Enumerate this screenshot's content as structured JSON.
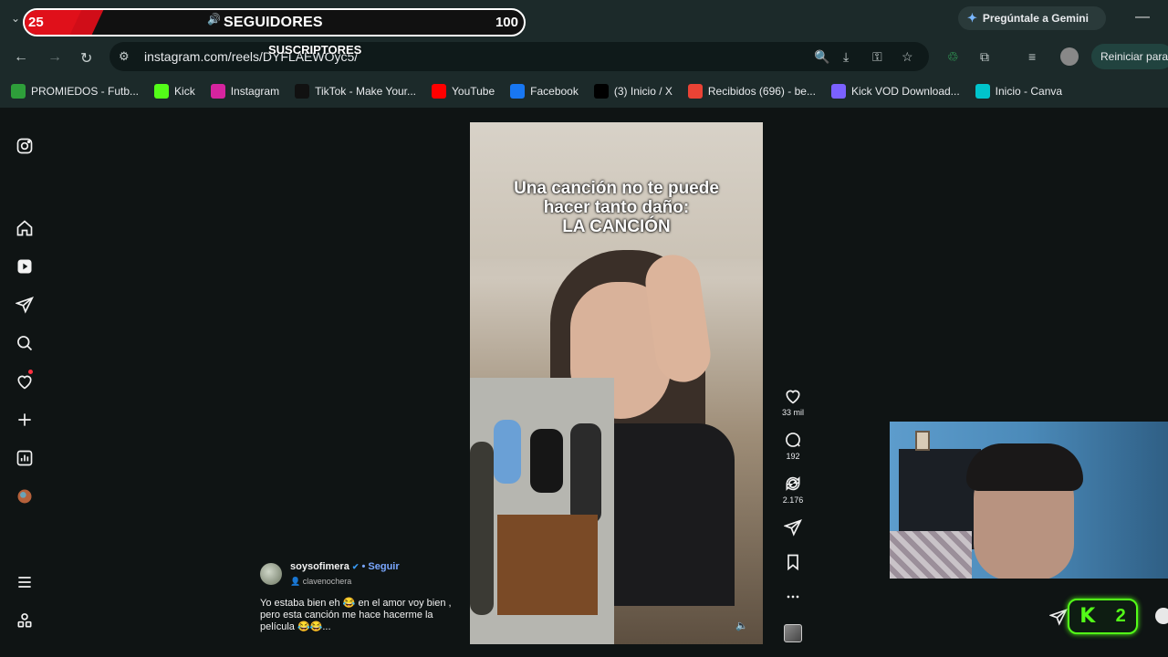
{
  "overlay": {
    "left_count": "25",
    "label": "SEGUIDORES",
    "right_count": "100",
    "sublabel": "SUSCRIPTORES",
    "progress_fraction": 0.25,
    "fill_color": "#e0101a"
  },
  "browser": {
    "gemini_label": "Pregúntale a Gemini",
    "url": "instagram.com/reels/DYFLAEWOyc5/",
    "restart_label": "Reiniciar para",
    "accent": "#1c2a2a"
  },
  "bookmarks": [
    {
      "label": "PROMIEDOS - Futb...",
      "icon": "promiedos-icon",
      "color": "#2e9e3a"
    },
    {
      "label": "Kick",
      "icon": "kick-icon",
      "color": "#53fc18"
    },
    {
      "label": "Instagram",
      "icon": "instagram-icon",
      "color": "#d6249f"
    },
    {
      "label": "TikTok - Make Your...",
      "icon": "tiktok-icon",
      "color": "#111111"
    },
    {
      "label": "YouTube",
      "icon": "youtube-icon",
      "color": "#ff0000"
    },
    {
      "label": "Facebook",
      "icon": "facebook-icon",
      "color": "#1877f2"
    },
    {
      "label": "(3) Inicio / X",
      "icon": "x-icon",
      "color": "#000000"
    },
    {
      "label": "Recibidos (696) - be...",
      "icon": "gmail-icon",
      "color": "#ea4335"
    },
    {
      "label": "Kick VOD Download...",
      "icon": "kickvod-icon",
      "color": "#7b61ff"
    },
    {
      "label": "Inicio - Canva",
      "icon": "canva-icon",
      "color": "#00c4cc"
    }
  ],
  "reel": {
    "caption_line1": "Una canción no te puede",
    "caption_line2": "hacer tanto daño:",
    "caption_line3": "LA CANCIÓN",
    "likes": "33 mil",
    "comments": "192",
    "reposts": "2.176"
  },
  "author": {
    "username": "soysofimera",
    "follow": "Seguir",
    "audio": "clavenochera",
    "text": "Yo estaba bien eh 😂 en el amor voy bien , pero esta canción me hace hacerme la película 😂😂..."
  },
  "kick": {
    "logo": "K",
    "count": "2",
    "color": "#53fc18"
  }
}
